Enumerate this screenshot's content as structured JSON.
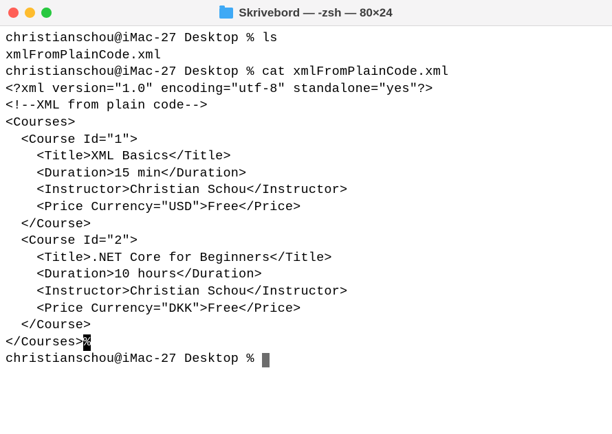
{
  "window": {
    "title": "Skrivebord — -zsh — 80×24"
  },
  "terminal": {
    "lines": [
      "christianschou@iMac-27 Desktop % ls",
      "xmlFromPlainCode.xml",
      "christianschou@iMac-27 Desktop % cat xmlFromPlainCode.xml",
      "<?xml version=\"1.0\" encoding=\"utf-8\" standalone=\"yes\"?>",
      "<!--XML from plain code-->",
      "<Courses>",
      "  <Course Id=\"1\">",
      "    <Title>XML Basics</Title>",
      "    <Duration>15 min</Duration>",
      "    <Instructor>Christian Schou</Instructor>",
      "    <Price Currency=\"USD\">Free</Price>",
      "  </Course>",
      "  <Course Id=\"2\">",
      "    <Title>.NET Core for Beginners</Title>",
      "    <Duration>10 hours</Duration>",
      "    <Instructor>Christian Schou</Instructor>",
      "    <Price Currency=\"DKK\">Free</Price>",
      "  </Course>"
    ],
    "closing_tag": "</Courses>",
    "eof_marker": "%",
    "final_prompt": "christianschou@iMac-27 Desktop % "
  }
}
